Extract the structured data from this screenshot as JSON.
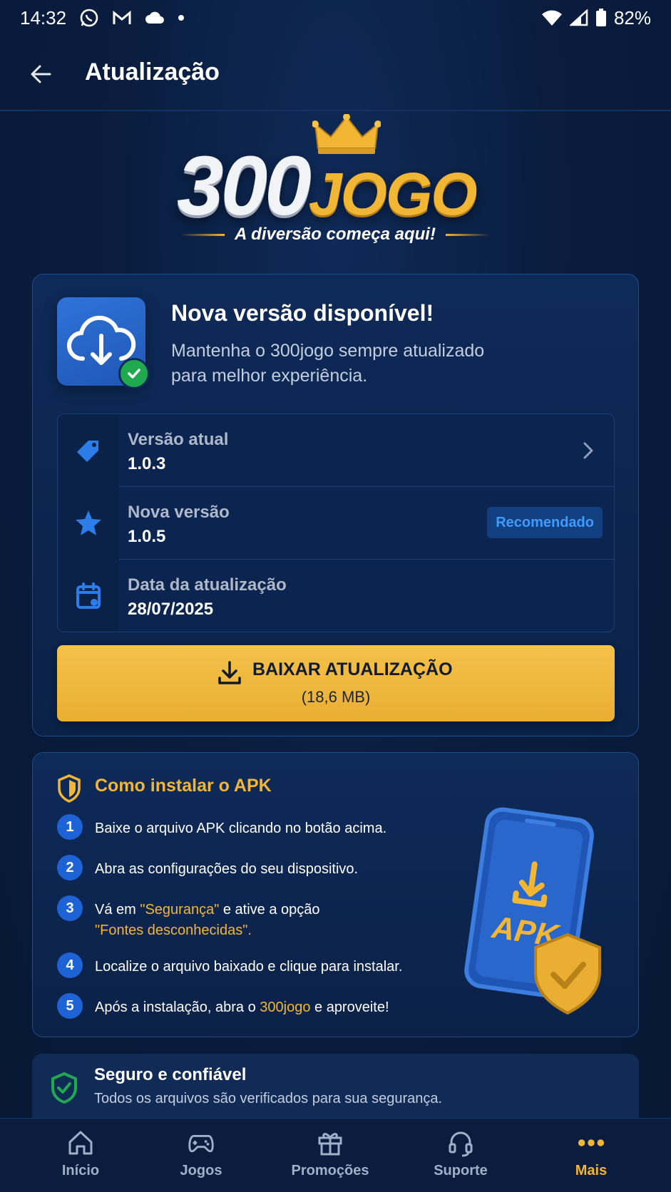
{
  "status_bar": {
    "time": "14:32",
    "battery": "82%",
    "icons": [
      "whatsapp-icon",
      "gmail-icon",
      "cloud-icon",
      "dot-icon",
      "wifi-icon",
      "signal-icon",
      "battery-icon"
    ]
  },
  "header": {
    "title": "Atualização",
    "back_icon": "arrow-left-icon"
  },
  "logo": {
    "part1": "300",
    "part2": "JOGO",
    "tagline": "A diversão começa aqui!"
  },
  "update_card": {
    "title": "Nova versão disponível!",
    "description": "Mantenha o 300jogo sempre atualizado para melhor experiência.",
    "rows": [
      {
        "icon": "tag-icon",
        "label": "Versão atual",
        "value": "1.0.3"
      },
      {
        "icon": "star-icon",
        "label": "Nova versão",
        "value": "1.0.5",
        "badge": "Recomendado"
      },
      {
        "icon": "calendar-icon",
        "label": "Data da atualização",
        "value": "28/07/2025"
      }
    ],
    "download_button": {
      "label": "BAIXAR ATUALIZAÇÃO",
      "size": "(18,6 MB)"
    }
  },
  "install_card": {
    "title": "Como instalar o APK",
    "steps": [
      {
        "num": "1",
        "text": "Baixe o arquivo APK clicando no botão acima."
      },
      {
        "num": "2",
        "text": "Abra as configurações do seu dispositivo."
      },
      {
        "num": "3",
        "before": "Vá em ",
        "highlight1": "\"Segurança\"",
        "middle": " e ative a opção",
        "highlight2": "\"Fontes desconhecidas\"."
      },
      {
        "num": "4",
        "text": "Localize o arquivo baixado e clique para instalar."
      },
      {
        "num": "5",
        "before": "Após a instalação, abra o ",
        "highlight1": "300jogo",
        "after": " e aproveite!"
      }
    ],
    "illustration_label": "APK"
  },
  "safe_card": {
    "title": "Seguro e confiável",
    "description": "Todos os arquivos são verificados para sua segurança."
  },
  "bottom_nav": {
    "items": [
      {
        "icon": "home-icon",
        "label": "Início"
      },
      {
        "icon": "gamepad-icon",
        "label": "Jogos"
      },
      {
        "icon": "gift-icon",
        "label": "Promoções"
      },
      {
        "icon": "headset-icon",
        "label": "Suporte"
      },
      {
        "icon": "more-icon",
        "label": "Mais",
        "active": true
      }
    ]
  },
  "colors": {
    "background": "#0a1d3f",
    "accent": "#f2b635",
    "primary_blue": "#1e63d6",
    "success": "#21a94f"
  }
}
